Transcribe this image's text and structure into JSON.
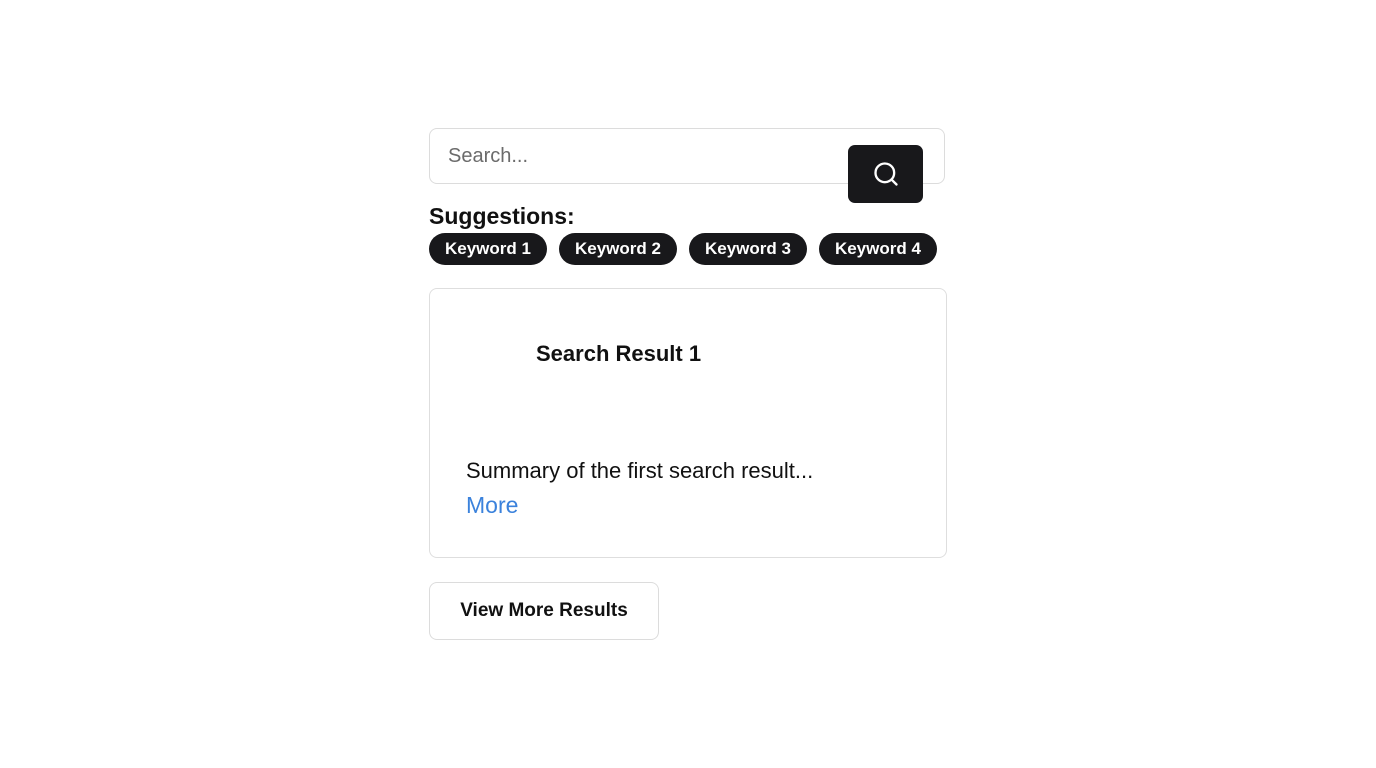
{
  "search": {
    "placeholder": "Search...",
    "value": "",
    "button_icon": "search-icon"
  },
  "suggestions": {
    "heading": "Suggestions:",
    "keywords": [
      "Keyword 1",
      "Keyword 2",
      "Keyword 3",
      "Keyword 4"
    ]
  },
  "results": [
    {
      "title": "Search Result 1",
      "summary": "Summary of the first search result...",
      "more_label": "More"
    }
  ],
  "view_more_label": "View More Results",
  "colors": {
    "primary": "#18181b",
    "link": "#3b82dc",
    "border": "#dcdcdc",
    "background": "#ffffff"
  }
}
